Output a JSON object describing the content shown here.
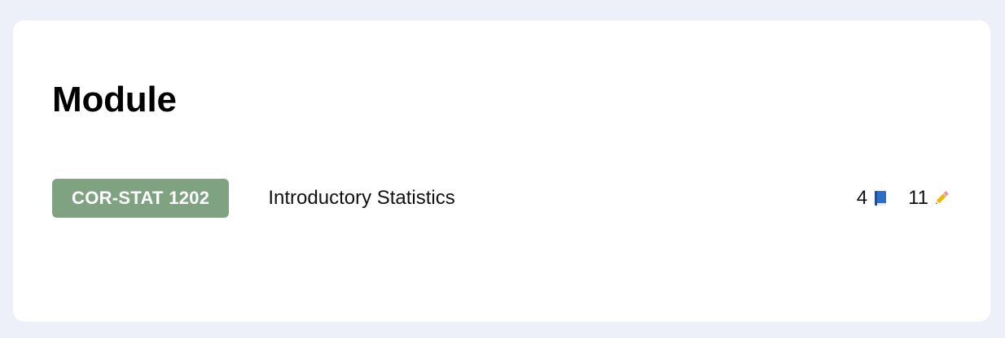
{
  "page": {
    "title": "Module"
  },
  "module": {
    "code": "COR-STAT 1202",
    "name": "Introductory Statistics",
    "badge_color": "#7fa281",
    "stats": [
      {
        "value": "4",
        "icon": "book-icon"
      },
      {
        "value": "11",
        "icon": "pencil-icon"
      }
    ]
  }
}
